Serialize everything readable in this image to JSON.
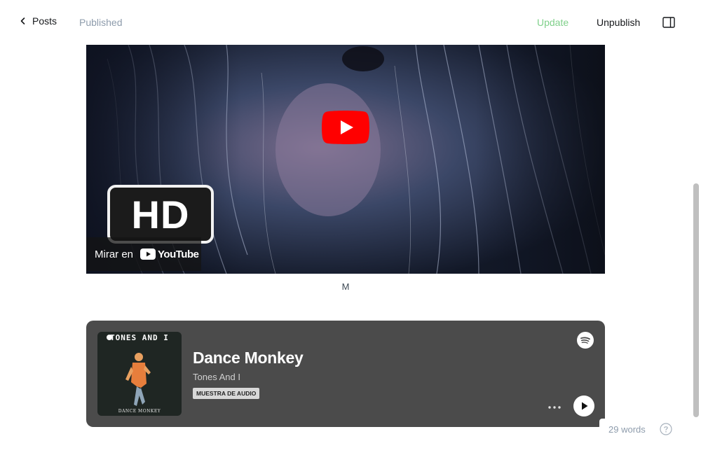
{
  "header": {
    "back_label": "Posts",
    "status": "Published",
    "update_label": "Update",
    "unpublish_label": "Unpublish",
    "icons": {
      "back": "chevron-left-icon",
      "sidebar": "sidebar-toggle-icon"
    },
    "colors": {
      "update": "#7fd08a",
      "status": "#8e9cac"
    }
  },
  "video_embed": {
    "hd_badge": "HD",
    "watch_on_label": "Mirar en",
    "platform": "YouTube",
    "caption": "M",
    "icons": {
      "play": "youtube-play-icon"
    },
    "colors": {
      "play": "#ff0000"
    }
  },
  "spotify_embed": {
    "cover_title": "TONES AND I",
    "cover_footer": "DANCE MONKEY",
    "title": "Dance Monkey",
    "artist": "Tones And I",
    "badge": "MUESTRA DE AUDIO",
    "icons": {
      "logo": "spotify-icon",
      "more": "more-horizontal-icon",
      "play": "play-icon"
    },
    "colors": {
      "card_bg": "#4b4b4b"
    }
  },
  "footer": {
    "word_count": "29 words",
    "icons": {
      "help": "question-circle-icon"
    }
  }
}
